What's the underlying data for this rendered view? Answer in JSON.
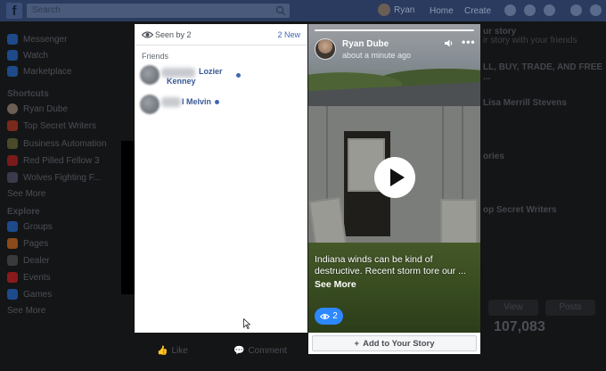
{
  "topbar": {
    "logo": "f",
    "search_placeholder": "Search",
    "user_name": "Ryan",
    "links": [
      "Home",
      "Create"
    ]
  },
  "left_nav": {
    "items": [
      {
        "label": "Messenger",
        "color": "#1d4a8a"
      },
      {
        "label": "Watch",
        "color": "#1d4a8a"
      },
      {
        "label": "Marketplace",
        "color": "#1d4a8a"
      }
    ],
    "shortcuts_heading": "Shortcuts",
    "shortcuts": [
      {
        "label": "Ryan Dube",
        "color": "#6b5e55"
      },
      {
        "label": "Top Secret Writers",
        "color": "#7a2a1a"
      },
      {
        "label": "Business Automation",
        "color": "#4a4a2a"
      },
      {
        "label": "Red Pilled Fellow 3",
        "color": "#7a1a1a"
      },
      {
        "label": "Wolves Fighting F...",
        "color": "#3a3a4a"
      }
    ],
    "see_more_1": "See More",
    "explore_heading": "Explore",
    "explore": [
      {
        "label": "Groups",
        "color": "#1d4a8a"
      },
      {
        "label": "Pages",
        "color": "#8a4a1a"
      },
      {
        "label": "Dealer",
        "color": "#3a3a3a"
      },
      {
        "label": "Events",
        "color": "#8a1a1a"
      },
      {
        "label": "Games",
        "color": "#1d4a8a"
      }
    ],
    "see_more_2": "See More"
  },
  "feed_actions": {
    "like": "Like",
    "comment": "Comment"
  },
  "right_col": {
    "line1": "ur story",
    "line2": "ir story with your friends",
    "line3": "LL, BUY, TRADE, AND FREE ...",
    "line4": "Lisa Merrill Stevens",
    "line5": "ories",
    "line6": "op Secret Writers",
    "btn_view": "View",
    "btn_posts": "Posts",
    "stat": "107,083"
  },
  "viewers_panel": {
    "seen_by": "Seen by 2",
    "new_count": "2 New",
    "friends_label": "Friends",
    "viewers": [
      {
        "name_line1": "Lozier",
        "name_line2": "Kenney"
      },
      {
        "name_line1": "l Melvin",
        "name_line2": ""
      }
    ]
  },
  "story": {
    "author": "Ryan Dube",
    "time": "about a minute ago",
    "caption": "Indiana winds can be kind of destructive. Recent storm tore our ...",
    "see_more": "See More",
    "viewer_count": "2",
    "add_to_story": "Add to Your Story"
  },
  "colors": {
    "accent": "#4267b2",
    "badge": "#2d88ff",
    "link": "#385898"
  }
}
